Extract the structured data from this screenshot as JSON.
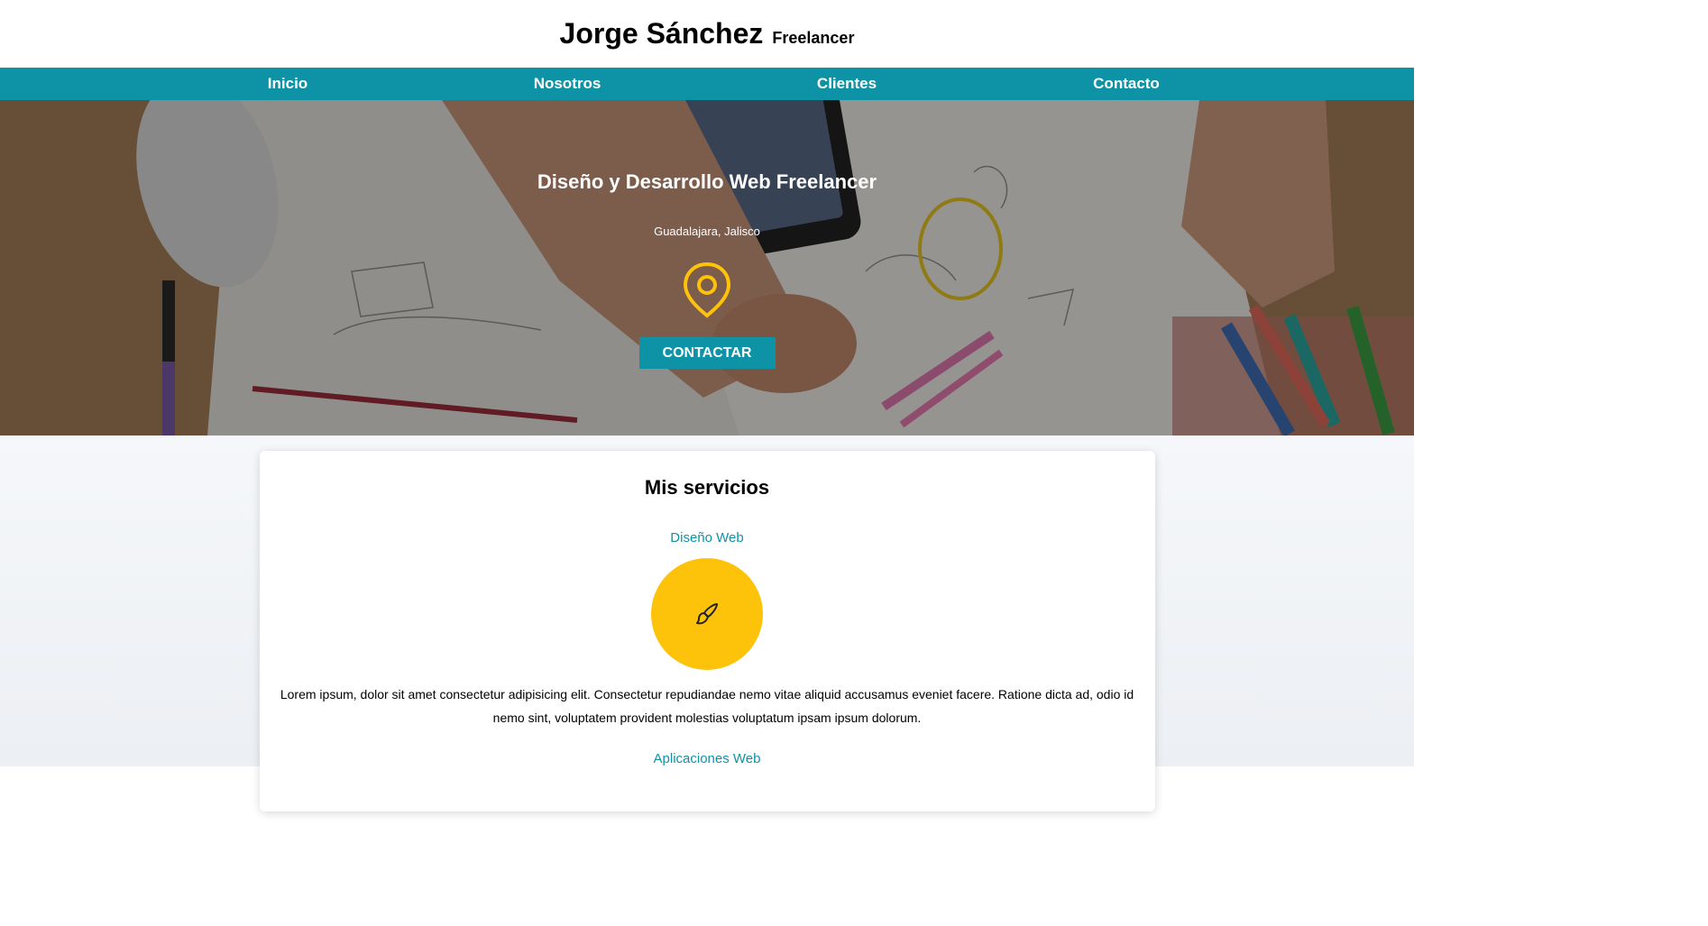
{
  "header": {
    "name": "Jorge Sánchez",
    "tagline": "Freelancer"
  },
  "nav": {
    "items": [
      {
        "label": "Inicio"
      },
      {
        "label": "Nosotros"
      },
      {
        "label": "Clientes"
      },
      {
        "label": "Contacto"
      }
    ]
  },
  "hero": {
    "title": "Diseño y Desarrollo Web Freelancer",
    "location": "Guadalajara, Jalisco",
    "icon": "location-pin-icon",
    "button_label": "CONTACTAR"
  },
  "services": {
    "title": "Mis servicios",
    "items": [
      {
        "name": "Diseño Web",
        "icon": "paintbrush-icon",
        "description": "Lorem ipsum, dolor sit amet consectetur adipisicing elit. Consectetur repudiandae nemo vitae aliquid accusamus eveniet facere. Ratione dicta ad, odio id nemo sint, voluptatem provident molestias voluptatum ipsam ipsum dolorum."
      }
    ],
    "next_partial": "Aplicaciones Web"
  },
  "colors": {
    "primary": "#0e93a6",
    "accent": "#fdc20a",
    "white": "#ffffff"
  }
}
